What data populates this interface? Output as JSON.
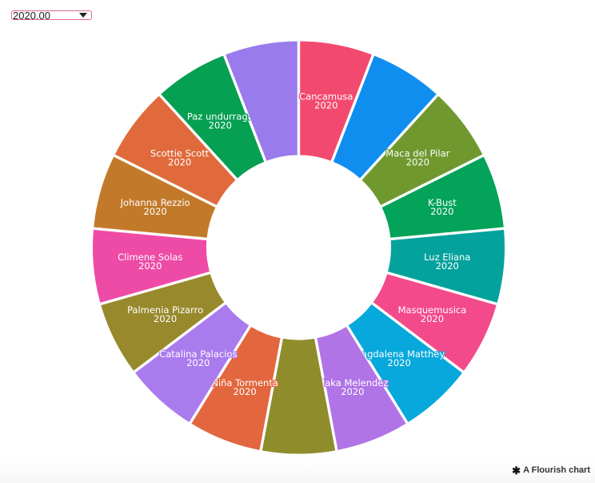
{
  "selector": {
    "value": "2020.00",
    "arrow_icon": "caret-down-icon"
  },
  "credit": {
    "icon": "flourish-star-icon",
    "text": "A Flourish chart"
  },
  "chart_data": {
    "type": "pie",
    "variant": "donut",
    "year_label": "2020",
    "segments": [
      {
        "name": "Cancamusa",
        "value": 1,
        "color": "#f24a6e"
      },
      {
        "name": "",
        "value": 1,
        "color": "#0f8ef0"
      },
      {
        "name": "Maca del Pilar",
        "value": 1,
        "color": "#6f992e"
      },
      {
        "name": "K-Bust",
        "value": 1,
        "color": "#04a35a"
      },
      {
        "name": "Luz Eliana",
        "value": 1,
        "color": "#04a29c"
      },
      {
        "name": "Masquemusica",
        "value": 1,
        "color": "#f24a8a"
      },
      {
        "name": "Magdalena Matthey",
        "value": 1,
        "color": "#07a8dc"
      },
      {
        "name": "Maka Melendez",
        "value": 1,
        "color": "#b174e6"
      },
      {
        "name": "",
        "value": 1,
        "color": "#8f8c2c"
      },
      {
        "name": "Niña Tormenta",
        "value": 1,
        "color": "#e2663e"
      },
      {
        "name": "Catalina Palacios",
        "value": 1,
        "color": "#a97bed"
      },
      {
        "name": "Palmenia Pizarro",
        "value": 1,
        "color": "#98892c"
      },
      {
        "name": "Climene Solas",
        "value": 1,
        "color": "#ee4ba6"
      },
      {
        "name": "Johanna Rezzio",
        "value": 1,
        "color": "#c27a2a"
      },
      {
        "name": "Scottie Scott",
        "value": 1,
        "color": "#e06a3c"
      },
      {
        "name": "Paz undurraga",
        "value": 1,
        "color": "#06a052"
      },
      {
        "name": "",
        "value": 1,
        "color": "#9a7bec"
      }
    ]
  }
}
